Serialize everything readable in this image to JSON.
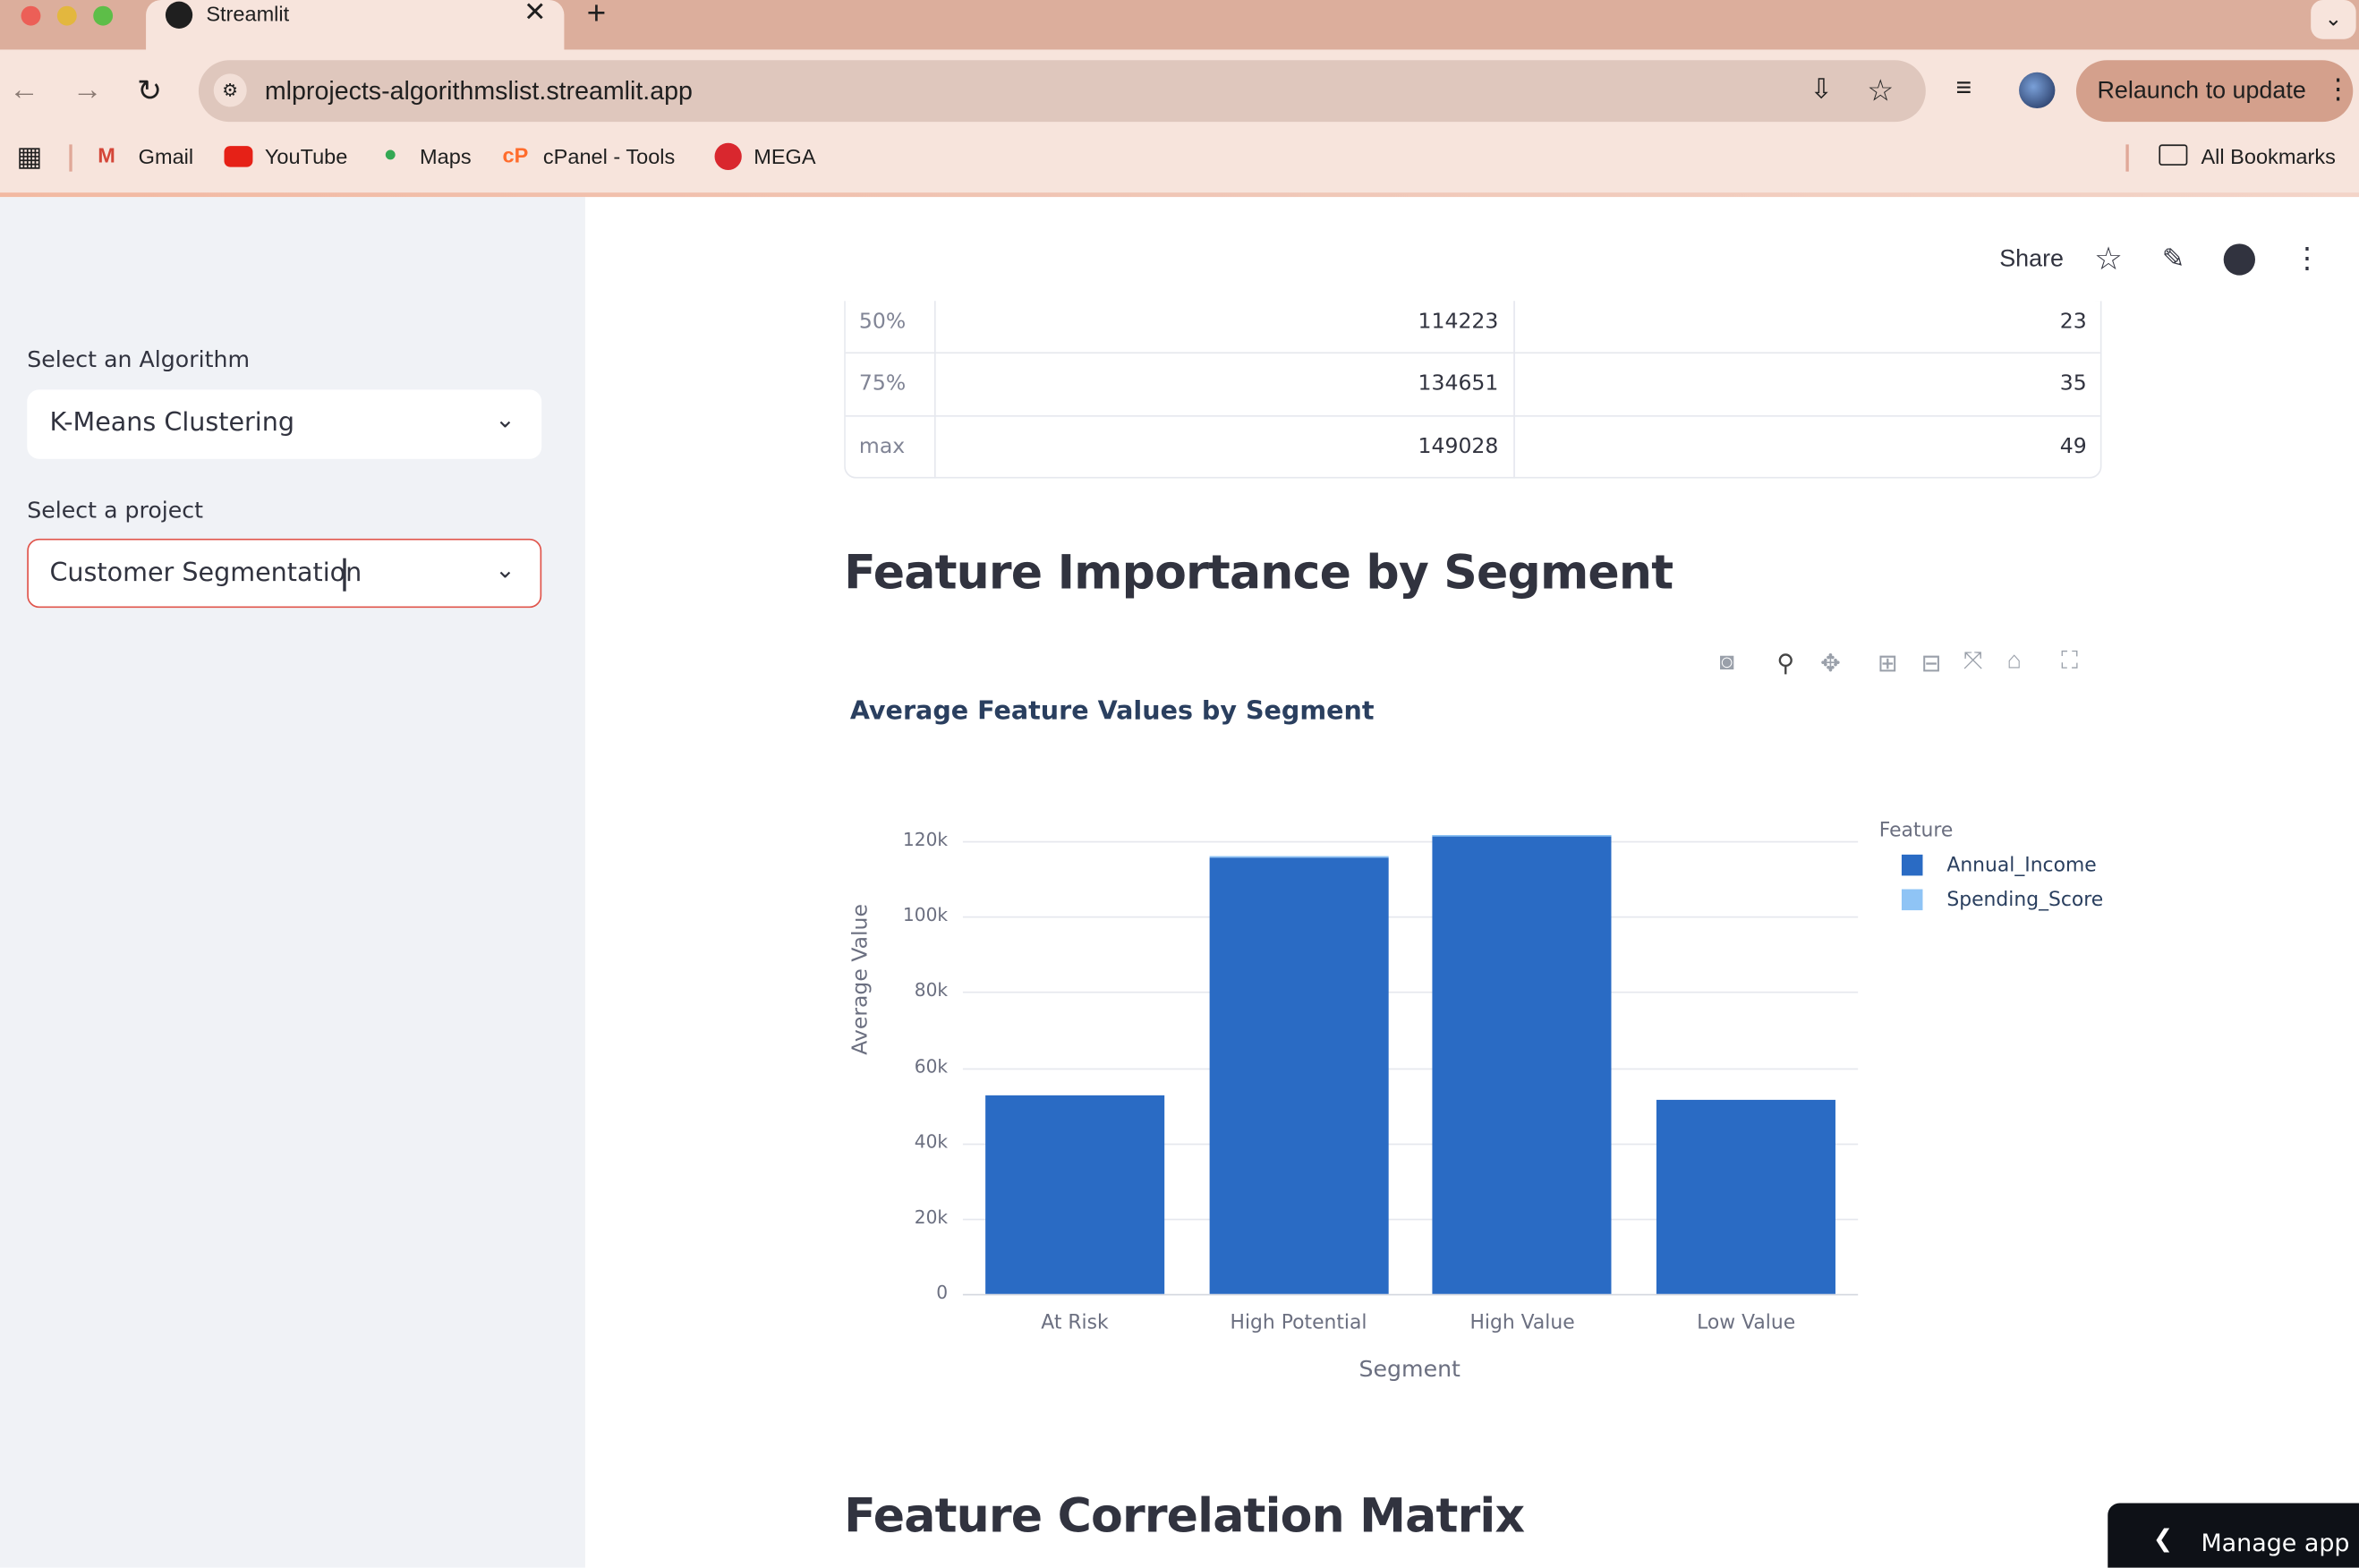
{
  "browser": {
    "tab_title": "Streamlit",
    "url": "mlprojects-algorithmslist.streamlit.app",
    "relaunch_label": "Relaunch to update",
    "bookmarks": [
      "Gmail",
      "YouTube",
      "Maps",
      "cPanel - Tools",
      "MEGA"
    ],
    "all_bookmarks": "All Bookmarks"
  },
  "sidebar": {
    "algorithm_label": "Select an Algorithm",
    "algorithm_value": "K-Means Clustering",
    "project_label": "Select a project",
    "project_value": "Customer Segmentation"
  },
  "header": {
    "share_label": "Share"
  },
  "stats_table": {
    "rows": [
      {
        "index": "50%",
        "annual_income": "114223",
        "spending_score": "23"
      },
      {
        "index": "75%",
        "annual_income": "134651",
        "spending_score": "35"
      },
      {
        "index": "max",
        "annual_income": "149028",
        "spending_score": "49"
      }
    ]
  },
  "section1_title": "Feature Importance by Segment",
  "section2_title": "Feature Correlation Matrix",
  "chart_data": {
    "type": "bar",
    "title": "Average Feature Values by Segment",
    "xlabel": "Segment",
    "ylabel": "Average Value",
    "categories": [
      "At Risk",
      "High Potential",
      "High Value",
      "Low Value"
    ],
    "series": [
      {
        "name": "Annual_Income",
        "color": "#2a6bc4",
        "values": [
          52500,
          115800,
          121500,
          51400
        ]
      },
      {
        "name": "Spending_Score",
        "color": "#8fc4f5",
        "values": [
          15,
          22,
          35,
          12
        ]
      }
    ],
    "ylim": [
      0,
      125000
    ],
    "y_ticks": [
      0,
      20000,
      40000,
      60000,
      80000,
      100000,
      120000
    ],
    "y_tick_labels": [
      "0",
      "20k",
      "40k",
      "60k",
      "80k",
      "100k",
      "120k"
    ],
    "legend_title": "Feature",
    "legend_position": "top-right",
    "grid": true
  },
  "manage_app_label": "Manage app"
}
